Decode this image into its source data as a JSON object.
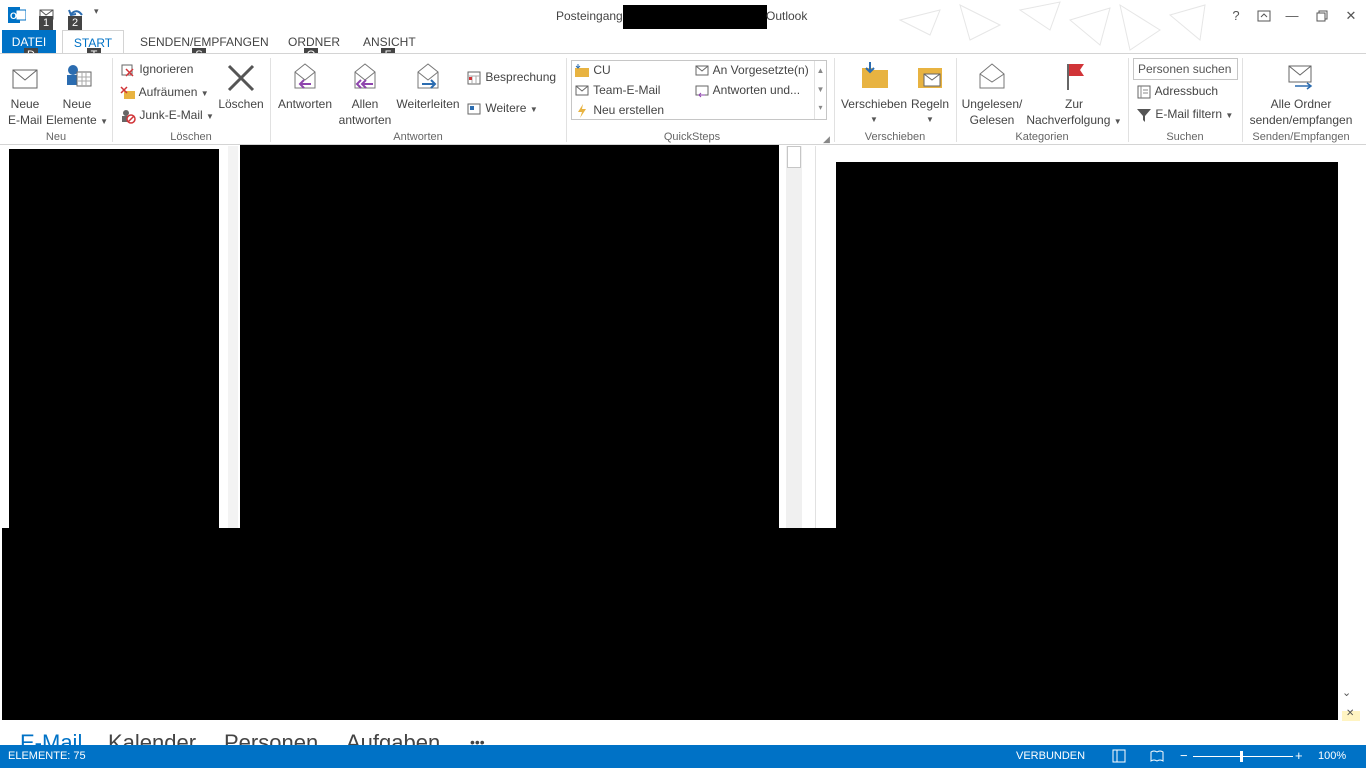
{
  "titlebar": {
    "title_left": "Posteingang",
    "title_right": "Outlook",
    "help": "?",
    "keytips": [
      "1",
      "2"
    ]
  },
  "tabs": [
    {
      "label": "DATEI",
      "keytip": "D"
    },
    {
      "label": "START",
      "keytip": "T"
    },
    {
      "label": "SENDEN/EMPFANGEN",
      "keytip": "S"
    },
    {
      "label": "ORDNER",
      "keytip": "O"
    },
    {
      "label": "ANSICHT",
      "keytip": "F"
    }
  ],
  "ribbon": {
    "neu": {
      "new_email": [
        "Neue",
        "E-Mail"
      ],
      "new_items": [
        "Neue",
        "Elemente"
      ],
      "label": "Neu"
    },
    "loeschen": {
      "ignore": "Ignorieren",
      "cleanup": "Aufräumen",
      "junk": "Junk-E-Mail",
      "delete": "Löschen",
      "label": "Löschen"
    },
    "antworten": {
      "reply": "Antworten",
      "reply_all": [
        "Allen",
        "antworten"
      ],
      "forward": "Weiterleiten",
      "meeting": "Besprechung",
      "more": "Weitere",
      "label": "Antworten"
    },
    "quicksteps": {
      "items": [
        "CU",
        "An Vorgesetzte(n)",
        "Team-E-Mail",
        "Antworten und...",
        "Neu erstellen"
      ],
      "label": "QuickSteps"
    },
    "verschieben": {
      "move": "Verschieben",
      "rules": "Regeln",
      "label": "Verschieben"
    },
    "kategorien": {
      "unread": [
        "Ungelesen/",
        "Gelesen"
      ],
      "followup": [
        "Zur",
        "Nachverfolgung"
      ],
      "label": "Kategorien"
    },
    "suchen": {
      "search_placeholder": "Personen suchen",
      "addressbook": "Adressbuch",
      "filter": "E-Mail filtern",
      "label": "Suchen"
    },
    "senden": {
      "sendall": [
        "Alle Ordner",
        "senden/empfangen"
      ],
      "label": "Senden/Empfangen"
    }
  },
  "nav": [
    "E-Mail",
    "Kalender",
    "Personen",
    "Aufgaben",
    "•••"
  ],
  "status": {
    "items": "ELEMENTE: 75",
    "connection": "VERBUNDEN",
    "zoom": "100%"
  }
}
